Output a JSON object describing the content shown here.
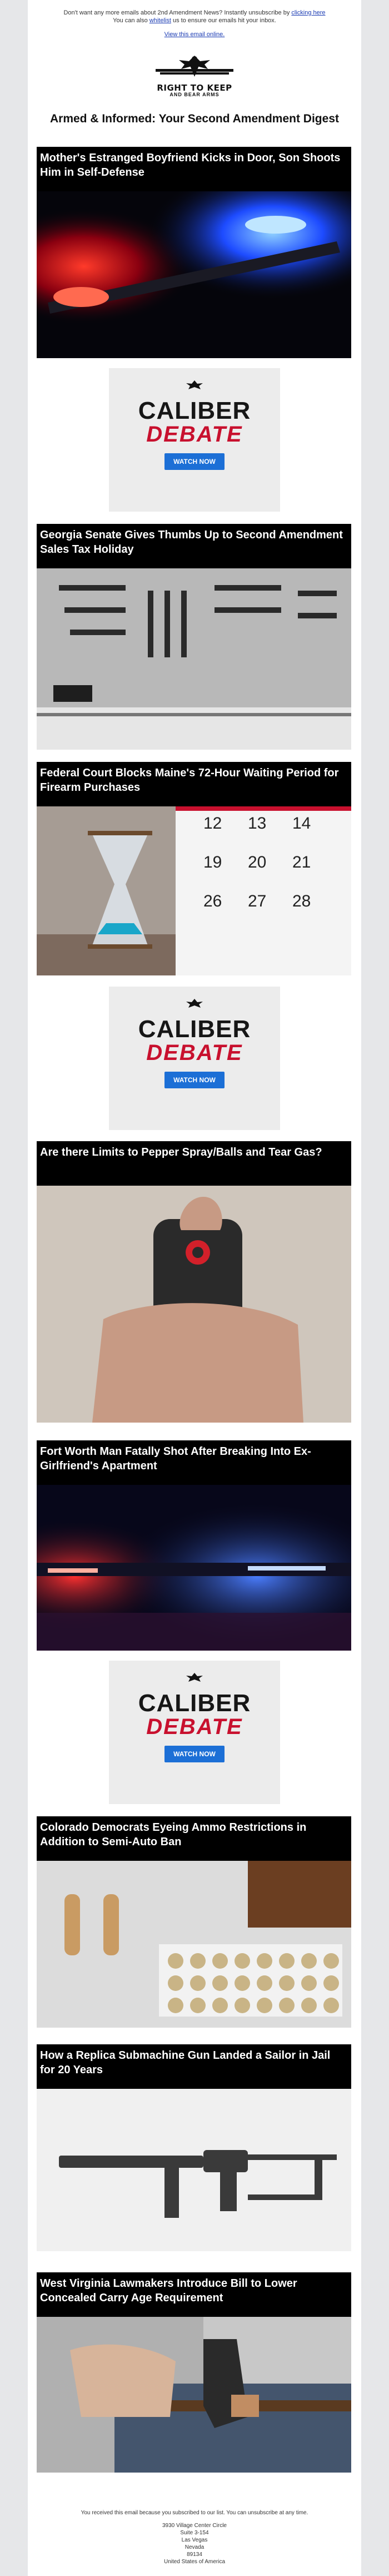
{
  "preheader": {
    "line1_prefix": "Don't want any more emails about 2nd Amendment News? Instantly unsubscribe by",
    "line1_link": "clicking here",
    "line2_prefix": "You can also",
    "line2_link": "whitelist",
    "line2_suffix": "us to ensure our emails hit your inbox."
  },
  "view_in_browser": "View this email online.",
  "brand": {
    "line1": "RIGHT TO KEEP",
    "line2": "AND BEAR ARMS"
  },
  "digest_title": "Armed & Informed: Your Second Amendment Digest",
  "articles": [
    {
      "title": "Mother's Estranged Boyfriend Kicks in Door, Son Shoots Him in Self-Defense"
    },
    {
      "title": "Georgia Senate Gives Thumbs Up to Second Amendment Sales Tax Holiday"
    },
    {
      "title": "Federal Court Blocks Maine's 72-Hour Waiting Period for Firearm Purchases"
    },
    {
      "title": "Are there Limits to Pepper Spray/Balls and Tear Gas?"
    },
    {
      "title": "Fort Worth Man Fatally Shot After Breaking Into Ex-Girlfriend's Apartment"
    },
    {
      "title": "Colorado Democrats Eyeing Ammo Restrictions in Addition to Semi-Auto Ban"
    },
    {
      "title": "How a Replica Submachine Gun Landed a Sailor in Jail for 20 Years"
    },
    {
      "title": "West Virginia Lawmakers Introduce Bill to Lower Concealed Carry Age Requirement"
    }
  ],
  "calendar_days": [
    "12",
    "13",
    "14",
    "19",
    "20",
    "21",
    "26",
    "27",
    "28"
  ],
  "ad": {
    "word1": "CALIBER",
    "word2": "DEBATE",
    "button": "WATCH NOW"
  },
  "footer": {
    "notice": "You received this email because you subscribed to our list. You can unsubscribe at any time.",
    "address1": "3930 Village Center Circle",
    "address2": "Suite 3-154",
    "city": "Las Vegas",
    "state": "Nevada",
    "zip": "89134",
    "country": "United States of America"
  },
  "colors": {
    "page_bg": "#e6e7e9",
    "title_bar": "#000000",
    "ad_accent": "#c8102e",
    "ad_button": "#1c6fd6"
  }
}
